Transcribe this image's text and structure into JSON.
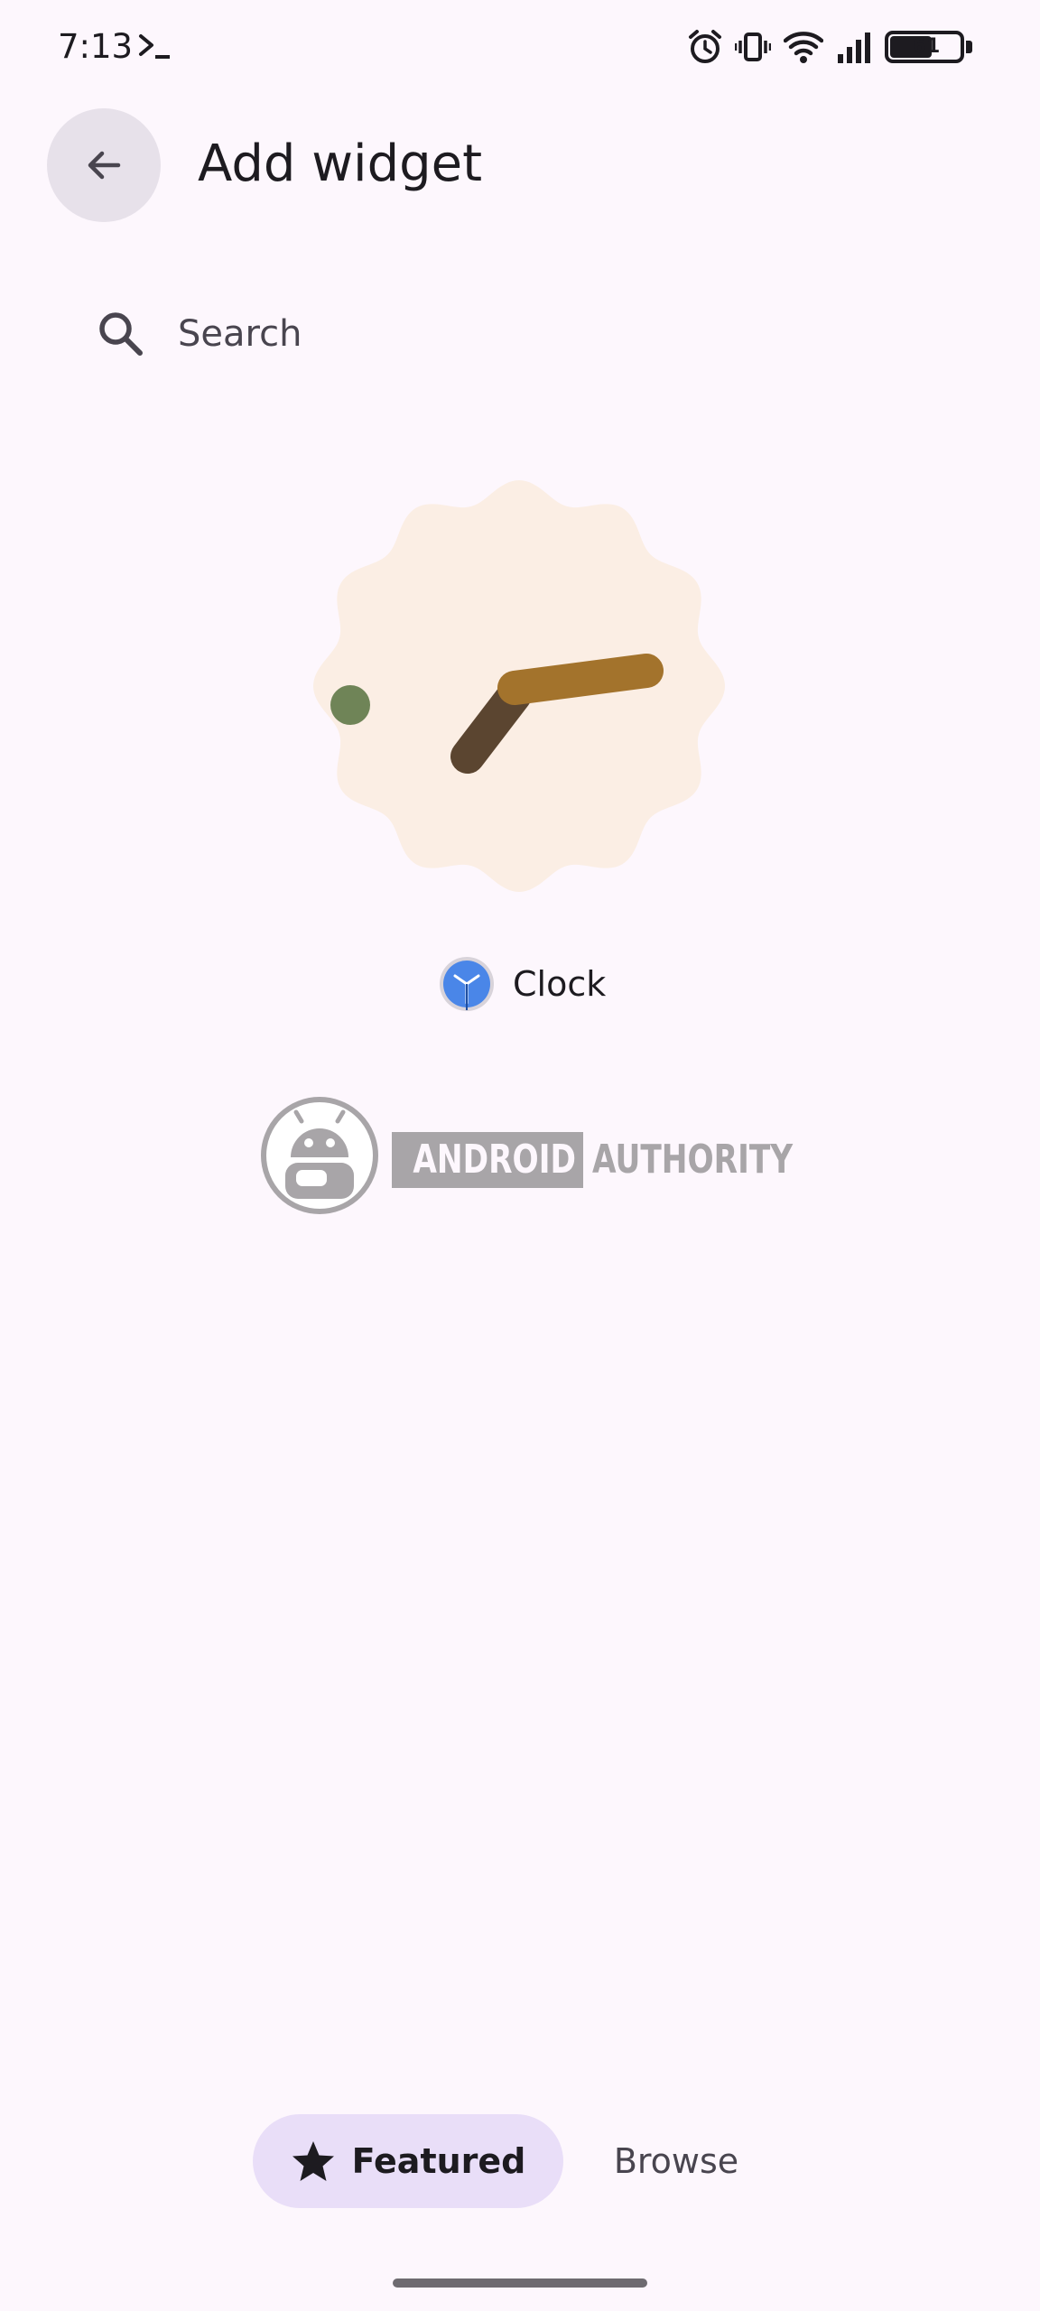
{
  "status_bar": {
    "time": "7:13",
    "battery_level": "61",
    "icons": [
      "terminal-icon",
      "alarm-icon",
      "vibrate-icon",
      "wifi-icon",
      "cell-signal-icon",
      "battery-icon"
    ]
  },
  "header": {
    "back_icon": "arrow-back-icon",
    "title": "Add widget"
  },
  "search": {
    "icon": "search-icon",
    "placeholder": "Search"
  },
  "widget": {
    "preview_icon": "analog-clock-widget",
    "app_icon": "clock-app-icon",
    "app_name": "Clock",
    "colors": {
      "face": "#fbeee4",
      "hour_hand": "#5b4530",
      "minute_hand": "#a3732c",
      "second_dot": "#6f8457",
      "app_icon_blue": "#4a86e8"
    }
  },
  "watermark": {
    "logo_icon": "android-authority-logo",
    "word1": "ANDROID",
    "word2": "AUTHORITY"
  },
  "tabs": [
    {
      "label": "Featured",
      "icon": "star-icon",
      "selected": true
    },
    {
      "label": "Browse",
      "selected": false
    }
  ],
  "colors": {
    "background": "#fdf7fd",
    "selected_tab": "#e9def8"
  }
}
